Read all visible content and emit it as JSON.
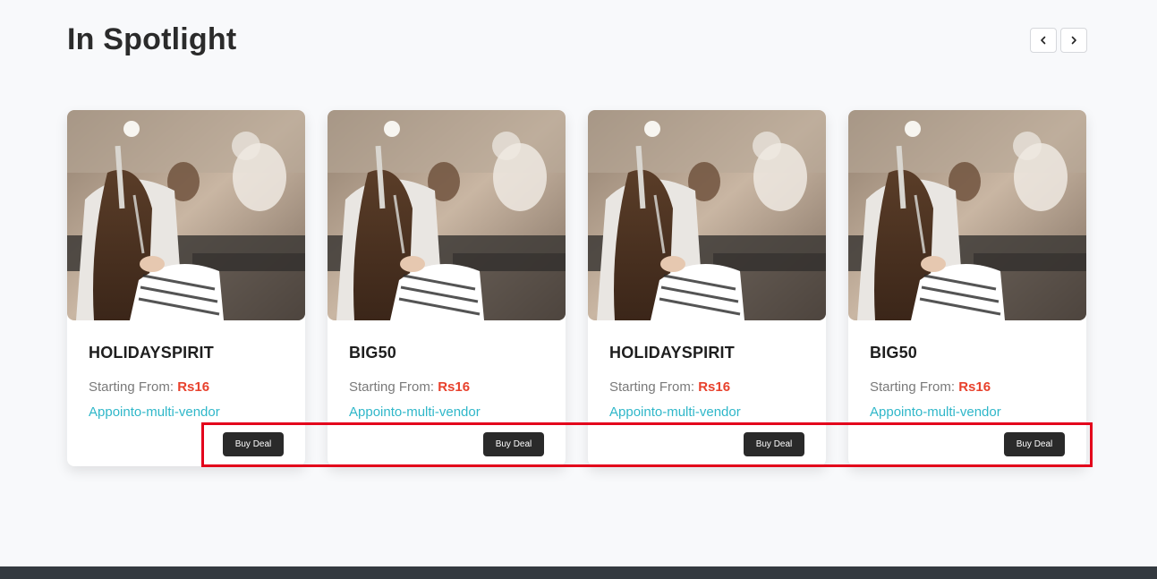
{
  "section": {
    "title": "In Spotlight"
  },
  "nav": {
    "prev_icon": "chevron-left-icon",
    "next_icon": "chevron-right-icon"
  },
  "cards": [
    {
      "code": "HOLIDAYSPIRIT",
      "starting_label": "Starting From:",
      "price": "Rs16",
      "vendor": "Appointo-multi-vendor",
      "button": "Buy Deal"
    },
    {
      "code": "BIG50",
      "starting_label": "Starting From:",
      "price": "Rs16",
      "vendor": "Appointo-multi-vendor",
      "button": "Buy Deal"
    },
    {
      "code": "HOLIDAYSPIRIT",
      "starting_label": "Starting From:",
      "price": "Rs16",
      "vendor": "Appointo-multi-vendor",
      "button": "Buy Deal"
    },
    {
      "code": "BIG50",
      "starting_label": "Starting From:",
      "price": "Rs16",
      "vendor": "Appointo-multi-vendor",
      "button": "Buy Deal"
    }
  ],
  "colors": {
    "price": "#e8412c",
    "vendor_link": "#2fb7c9",
    "button_bg": "#2a2a2a",
    "highlight": "#e3001b",
    "footer": "#343a40"
  }
}
